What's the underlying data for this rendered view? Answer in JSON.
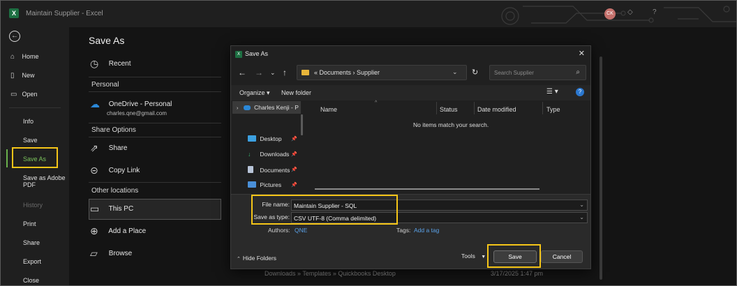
{
  "window": {
    "app_icon": "X",
    "title": "Maintain Supplier  -  Excel",
    "user_initials": "CK",
    "help_icon": "?"
  },
  "leftnav": {
    "back": "←",
    "items": [
      {
        "label": "Home",
        "icon": "⌂"
      },
      {
        "label": "New",
        "icon": "▯"
      },
      {
        "label": "Open",
        "icon": "▭"
      },
      {
        "label": "Info"
      },
      {
        "label": "Save"
      },
      {
        "label": "Save As"
      },
      {
        "label": "Save as Adobe"
      },
      {
        "label": "PDF"
      },
      {
        "label": "History"
      },
      {
        "label": "Print"
      },
      {
        "label": "Share"
      },
      {
        "label": "Export"
      },
      {
        "label": "Close"
      }
    ]
  },
  "backstage": {
    "title": "Save As",
    "recent": "Recent",
    "personal": "Personal",
    "onedrive_name": "OneDrive - Personal",
    "onedrive_email": "charles.qne@gmail.com",
    "share_options": "Share Options",
    "share": "Share",
    "copy_link": "Copy Link",
    "other_locations": "Other locations",
    "this_pc": "This PC",
    "add_place": "Add a Place",
    "browse": "Browse",
    "recent_path": "Downloads » Templates » Quickbooks Desktop",
    "recent_date": "3/17/2025 1:47 pm"
  },
  "dialog": {
    "title": "Save As",
    "close": "✕",
    "breadcrumbs": "«  Documents  ›  Supplier",
    "search_placeholder": "Search Supplier",
    "organize": "Organize ▾",
    "new_folder": "New folder",
    "nav_pane": {
      "user": "Charles Kenji - P",
      "desktop": "Desktop",
      "downloads": "Downloads",
      "documents": "Documents",
      "pictures": "Pictures"
    },
    "columns": [
      "Name",
      "Status",
      "Date modified",
      "Type"
    ],
    "empty_message": "No items match your search.",
    "file_name_label": "File name:",
    "file_name_value": "Maintain Supplier - SQL",
    "save_type_label": "Save as type:",
    "save_type_value": "CSV UTF-8 (Comma delimited)",
    "authors_label": "Authors:",
    "authors_value": "QNE",
    "tags_label": "Tags:",
    "tags_value": "Add a tag",
    "hide_folders": "Hide Folders",
    "tools": "Tools",
    "save": "Save",
    "cancel": "Cancel"
  },
  "colors": {
    "accent_highlight": "#f5c518",
    "excel_green": "#1d6f42",
    "link_blue": "#5aa0e6"
  }
}
